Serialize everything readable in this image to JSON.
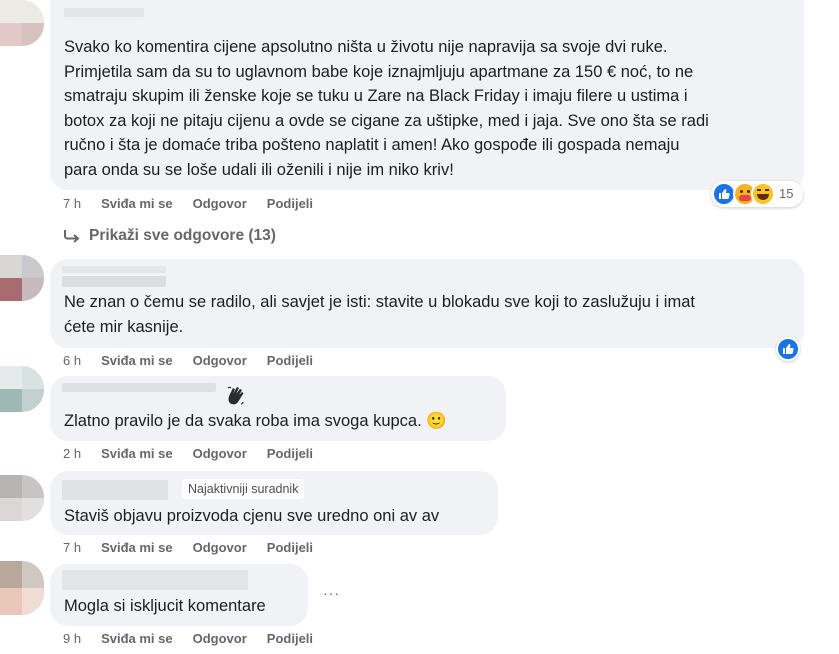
{
  "comments": [
    {
      "text_lines": [
        "Svako ko komentira cijene apsolutno ništa u životu nije napravija sa svoje dvi ruke.",
        "Primjetila sam da su to uglavnom babe koje iznajmljuju apartmane za 150 € noć, to ne",
        "smatraju skupim ili ženske koje se tuku u Zare na Black Friday i imaju filere u ustima i",
        "botox za koji ne pitaju cijenu a ovde se cigane za uštipke, med i jaja. Sve ono šta se radi",
        "ručno i šta je domaće triba pošteno naplatit i amen! Ako gospođe ili gospada nemaju",
        "para onda su se loše udali ili oženili i nije im niko kriv!"
      ],
      "time": "7 h",
      "reaction_count": "15"
    },
    {
      "text_lines": [
        "Ne znan o čemu se radilo, ali savjet je isti: stavite u blokadu sve koji to zaslužuju i imat",
        "ćete mir kasnije."
      ],
      "time": "6 h"
    },
    {
      "text_lines": [
        "Zlatno pravilo je da svaka roba ima svoga kupca. 🙂"
      ],
      "time": "2 h"
    },
    {
      "badge": "Najaktivniji suradnik",
      "text_lines": [
        "Staviš objavu proizvoda cjenu sve uredno oni av av"
      ],
      "time": "7 h"
    },
    {
      "text_lines": [
        "Mogla si iskljucit komentare"
      ],
      "time": "9 h"
    }
  ],
  "actions": {
    "like": "Sviđa mi se",
    "reply": "Odgovor",
    "share": "Podijeli"
  },
  "replies_link": "Prikaži sve odgovore (13)",
  "more_dots": "···",
  "icons": {
    "reply_arrow": "reply-arrow-icon",
    "like": "like-reaction-icon",
    "haha": "haha-reaction-icon",
    "wave": "wave-hand-icon"
  },
  "colors": {
    "bubble": "#f0f2f5",
    "meta": "#65676b",
    "like_blue": "#1b74e4"
  }
}
